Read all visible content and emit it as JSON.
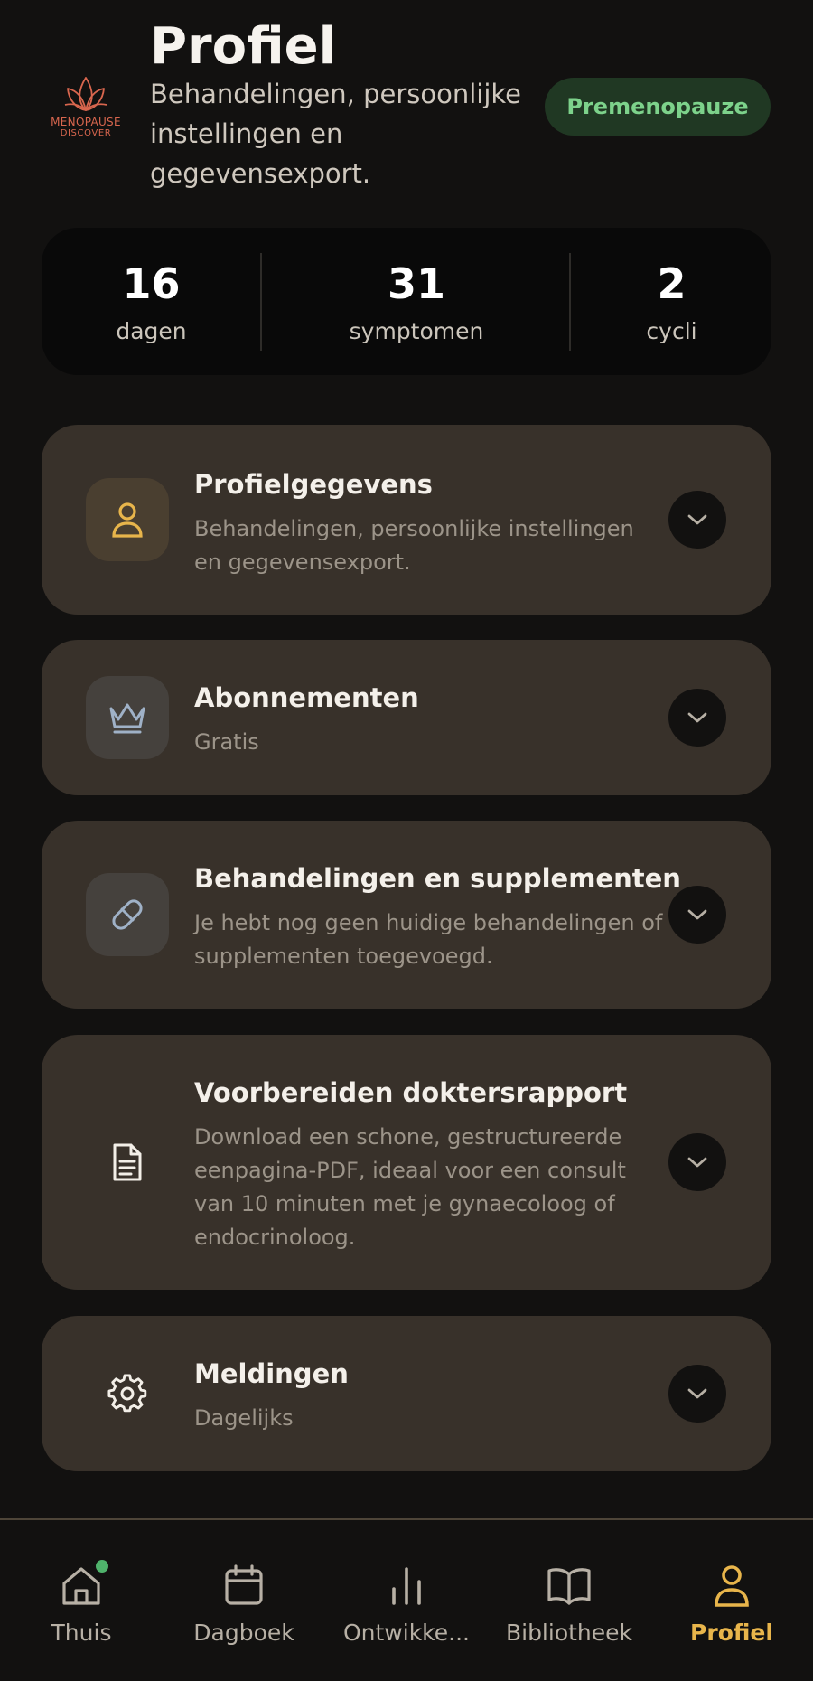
{
  "header": {
    "logo_line1": "MENOPAUSE",
    "logo_line2": "DISCOVER",
    "title": "Profiel",
    "subtitle": "Behandelingen, persoonlijke instellingen en gegevensexport.",
    "stage_badge": "Premenopauze"
  },
  "stats": [
    {
      "value": "16",
      "label": "dagen"
    },
    {
      "value": "31",
      "label": "symptomen"
    },
    {
      "value": "2",
      "label": "cycli"
    }
  ],
  "cards": [
    {
      "title": "Profielgegevens",
      "desc": "Behandelingen, persoonlijke instellingen en gegevensexport.",
      "icon": "user-icon"
    },
    {
      "title": "Abonnementen",
      "desc": "Gratis",
      "icon": "crown-icon"
    },
    {
      "title": "Behandelingen en supplementen",
      "desc": "Je hebt nog geen huidige behandelingen of supplementen toegevoegd.",
      "icon": "pill-icon"
    },
    {
      "title": "Voorbereiden doktersrapport",
      "desc": "Download een schone, gestructureerde eenpagina-PDF, ideaal voor een consult van 10 minuten met je gynaecoloog of endocrinoloog.",
      "icon": "document-icon"
    },
    {
      "title": "Meldingen",
      "desc": "Dagelijks",
      "icon": "gear-icon"
    }
  ],
  "nav": [
    {
      "label": "Thuis",
      "icon": "home-icon"
    },
    {
      "label": "Dagboek",
      "icon": "calendar-icon"
    },
    {
      "label": "Ontwikke...",
      "icon": "bar-chart-icon"
    },
    {
      "label": "Bibliotheek",
      "icon": "book-icon"
    },
    {
      "label": "Profiel",
      "icon": "user-icon",
      "active": true
    }
  ],
  "colors": {
    "background": "#121110",
    "card": "#38312a",
    "accent": "#e8b54b",
    "badge_bg": "#203823",
    "badge_text": "#7dd28b",
    "logo": "#d8664e",
    "notification": "#4fb26b"
  }
}
